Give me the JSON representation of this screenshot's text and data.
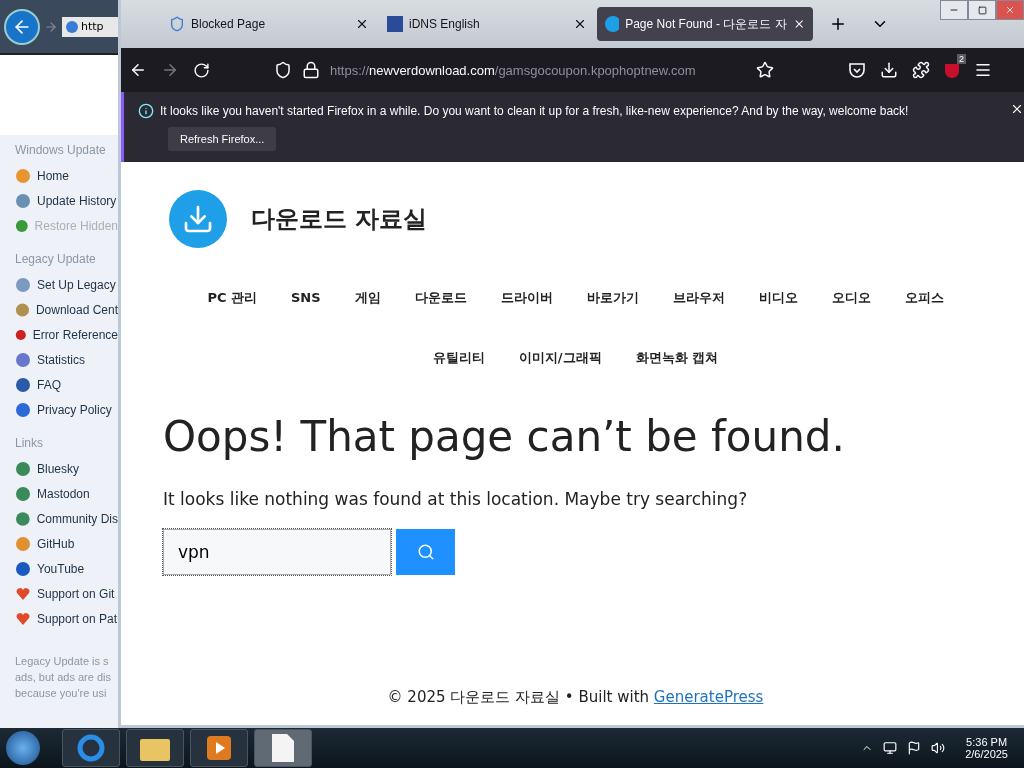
{
  "ie_window": {
    "address": "http",
    "sidebar": [
      {
        "heading": "Windows Update",
        "items": [
          {
            "label": "Home",
            "disabled": false
          },
          {
            "label": "Update History",
            "disabled": false
          },
          {
            "label": "Restore Hidden",
            "disabled": true
          }
        ]
      },
      {
        "heading": "Legacy Update",
        "items": [
          {
            "label": "Set Up Legacy",
            "disabled": false
          },
          {
            "label": "Download Cent",
            "disabled": false
          },
          {
            "label": "Error Reference",
            "disabled": false
          },
          {
            "label": "Statistics",
            "disabled": false
          },
          {
            "label": "FAQ",
            "disabled": false
          },
          {
            "label": "Privacy Policy",
            "disabled": false
          }
        ]
      },
      {
        "heading": "Links",
        "items": [
          {
            "label": "Bluesky",
            "disabled": false
          },
          {
            "label": "Mastodon",
            "disabled": false
          },
          {
            "label": "Community Dis",
            "disabled": false
          },
          {
            "label": "GitHub",
            "disabled": false
          },
          {
            "label": "YouTube",
            "disabled": false
          },
          {
            "label": "Support on Git",
            "disabled": false
          },
          {
            "label": "Support on Pat",
            "disabled": false
          }
        ]
      }
    ],
    "footer_lines": [
      "Legacy Update is s",
      "ads, but ads are dis",
      "because you're usi"
    ]
  },
  "firefox": {
    "tabs": [
      {
        "title": "Blocked Page",
        "selected": false
      },
      {
        "title": "iDNS English",
        "selected": false
      },
      {
        "title": "Page Not Found - 다운로드 자",
        "selected": true
      }
    ],
    "url": {
      "scheme": "https://",
      "host": "newverdownload.com",
      "path": "/gamsgocoupon.kpophoptnew.com"
    },
    "extension_badge": "2",
    "notification": {
      "message": "It looks like you haven't started Firefox in a while. Do you want to clean it up for a fresh, like-new experience? And by the way, welcome back!",
      "button": "Refresh Firefox..."
    },
    "page": {
      "site_title": "다운로드 자료실",
      "nav": [
        "PC 관리",
        "SNS",
        "게임",
        "다운로드",
        "드라이버",
        "바로가기",
        "브라우저",
        "비디오",
        "오디오",
        "오피스",
        "유틸리티",
        "이미지/그래픽",
        "화면녹화 캡쳐"
      ],
      "heading": "Oops! That page can’t be found.",
      "text": "It looks like nothing was found at this location. Maybe try searching?",
      "search_value": "vpn",
      "footer_text": "© 2025 다운로드 자료실 • Built with",
      "footer_link": "GeneratePress"
    }
  },
  "taskbar": {
    "apps": [
      {
        "active": false
      },
      {
        "active": false
      },
      {
        "active": false
      },
      {
        "active": true
      }
    ],
    "time": "5:36 PM",
    "date": "2/6/2025"
  }
}
